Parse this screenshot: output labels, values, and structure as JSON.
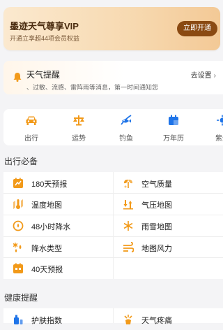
{
  "vip": {
    "title": "墨迹天气尊享VIP",
    "subtitle": "开通立享超44项会员权益",
    "button": "立即开通"
  },
  "weather_alert": {
    "title": "天气提醒",
    "subtitle": "、过敏、流感、雷阵雨等消息，第一时间通知您",
    "action": "去设置",
    "chevron": "›"
  },
  "tools": [
    {
      "label": "出行",
      "icon": "car-icon"
    },
    {
      "label": "运势",
      "icon": "scale-icon"
    },
    {
      "label": "钓鱼",
      "icon": "fishing-icon"
    },
    {
      "label": "万年历",
      "icon": "calendar-icon"
    },
    {
      "label": "紫外",
      "icon": "sun-icon"
    }
  ],
  "travel_section": {
    "title": "出行必备",
    "items": [
      {
        "label": "180天预报",
        "icon": "forecast-180-icon"
      },
      {
        "label": "空气质量",
        "icon": "air-quality-icon"
      },
      {
        "label": "温度地图",
        "icon": "temperature-map-icon"
      },
      {
        "label": "气压地图",
        "icon": "pressure-map-icon"
      },
      {
        "label": "48小时降水",
        "icon": "precipitation-48h-icon"
      },
      {
        "label": "雨雪地图",
        "icon": "rain-snow-map-icon"
      },
      {
        "label": "降水类型",
        "icon": "precipitation-type-icon"
      },
      {
        "label": "地图风力",
        "icon": "wind-map-icon"
      },
      {
        "label": "40天预报",
        "icon": "forecast-40-icon"
      }
    ]
  },
  "health_section": {
    "title": "健康提醒",
    "items": [
      {
        "label": "护肤指数",
        "icon": "skincare-icon"
      },
      {
        "label": "天气疼痛",
        "icon": "weather-pain-icon"
      }
    ]
  },
  "colors": {
    "accent": "#f29a1a",
    "blue": "#1f74e8",
    "vip_button": "#8a4a12"
  }
}
